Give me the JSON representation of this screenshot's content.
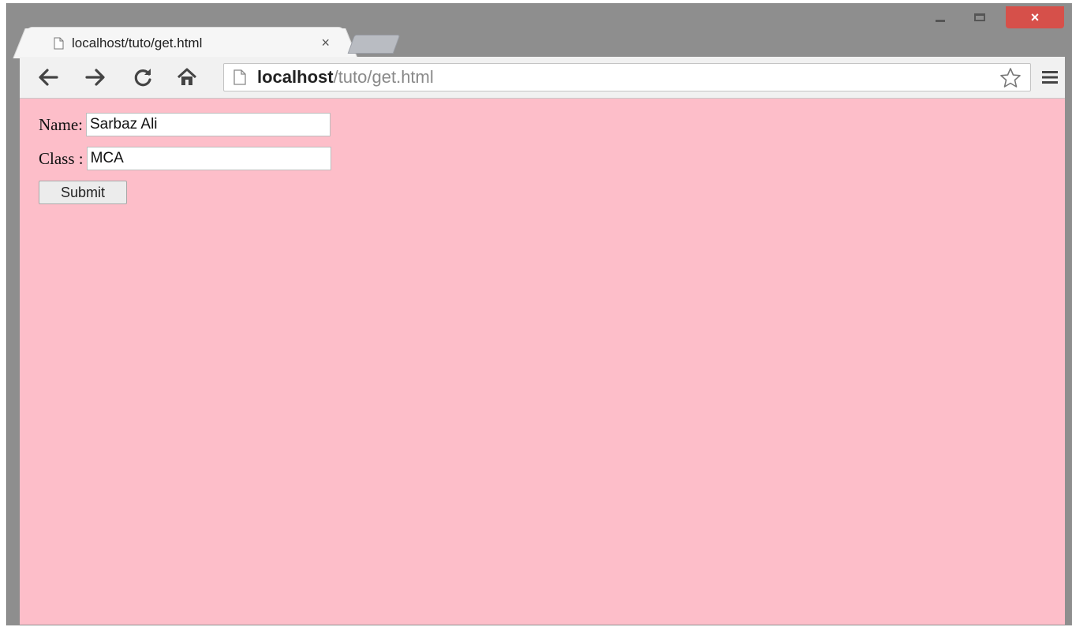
{
  "browser": {
    "tab_title": "localhost/tuto/get.html",
    "tab_close_glyph": "×",
    "close_glyph": "×",
    "url_host": "localhost",
    "url_path": "/tuto/get.html"
  },
  "form": {
    "name_label": "Name:",
    "name_value": "Sarbaz Ali",
    "class_label": "Class :",
    "class_value": "MCA",
    "submit_label": "Submit"
  },
  "colors": {
    "page_background": "#fdbec9",
    "window_frame": "#8e8e8e",
    "close_button": "#d6504a"
  },
  "icons": [
    "page-icon",
    "back-arrow-icon",
    "forward-arrow-icon",
    "reload-icon",
    "home-icon",
    "star-icon",
    "menu-icon",
    "minimize-icon",
    "maximize-icon",
    "close-icon"
  ]
}
